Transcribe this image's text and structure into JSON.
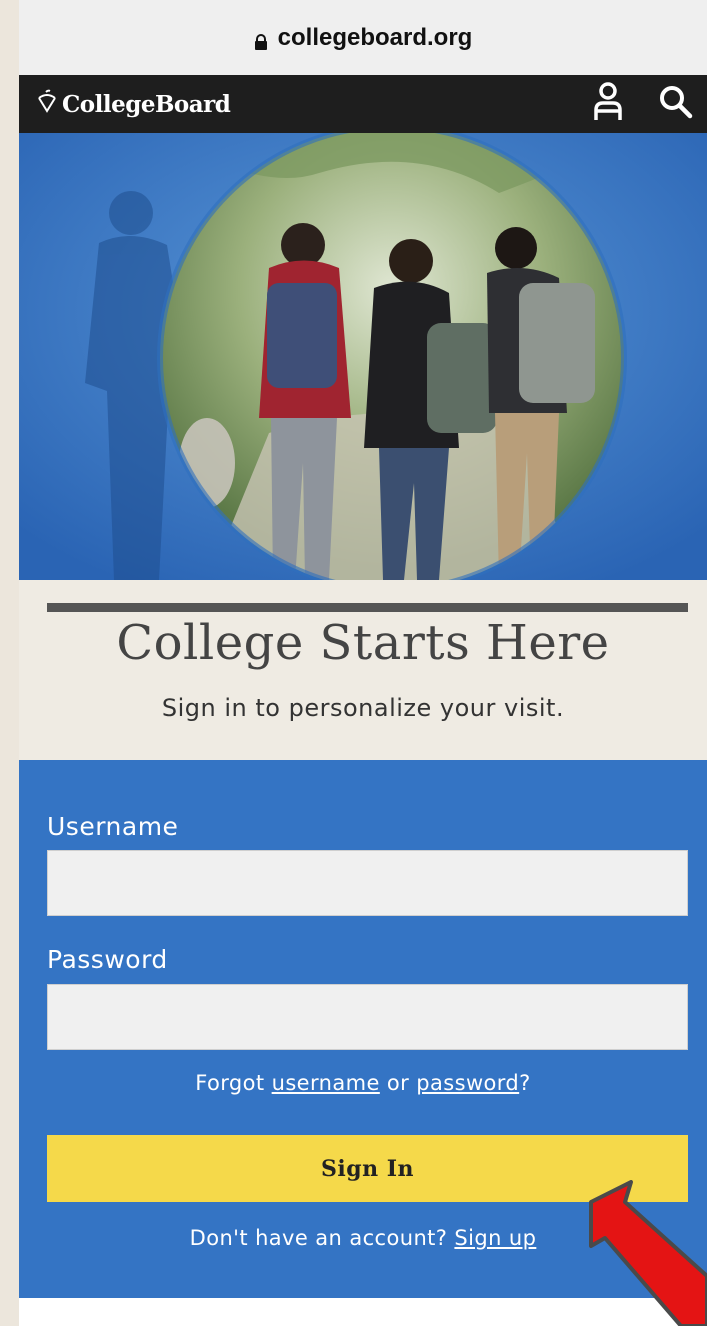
{
  "browser": {
    "url": "collegeboard.org",
    "lock_icon": "lock-icon"
  },
  "header": {
    "logo_text": "CollegeBoard",
    "logo_icon": "acorn-icon",
    "account_icon": "person-icon",
    "search_icon": "search-icon",
    "bg_color": "#1e1e1e"
  },
  "hero": {
    "image_alt": "students walking"
  },
  "intro": {
    "title": "College Starts Here",
    "subtitle": "Sign in to personalize your visit."
  },
  "login_form": {
    "username_label": "Username",
    "username_value": "",
    "password_label": "Password",
    "password_value": "",
    "forgot_prefix": "Forgot ",
    "forgot_username": "username",
    "forgot_or": " or ",
    "forgot_password": "password",
    "forgot_suffix": "?",
    "signin_label": "Sign In",
    "signup_prefix": "Don't have an account? ",
    "signup_link": "Sign up",
    "panel_color": "#3474c4",
    "button_color": "#f5d94a"
  },
  "annotation": {
    "arrow_color": "#e41414",
    "arrow_icon": "red-arrow-icon"
  }
}
